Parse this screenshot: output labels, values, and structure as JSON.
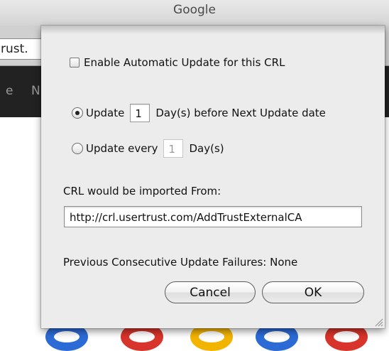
{
  "window": {
    "title": "Google"
  },
  "background": {
    "url_fragment": "rust.",
    "nav_fragment": "N"
  },
  "dialog": {
    "auto_update": {
      "label": "Enable Automatic Update for this CRL",
      "checked": false
    },
    "option_before": {
      "label_prefix": "Update",
      "value": "1",
      "label_suffix": "Day(s) before Next Update date",
      "selected": true
    },
    "option_every": {
      "label_prefix": "Update every",
      "value": "1",
      "label_suffix": "Day(s)",
      "selected": false
    },
    "import_label": "CRL would be imported From:",
    "import_url": "http://crl.usertrust.com/AddTrustExternalCA",
    "failures_text": "Previous Consecutive Update Failures: None",
    "cancel_label": "Cancel",
    "ok_label": "OK"
  },
  "colors": {
    "sheet_bg": "#ececec",
    "nav_bg": "#222222"
  }
}
